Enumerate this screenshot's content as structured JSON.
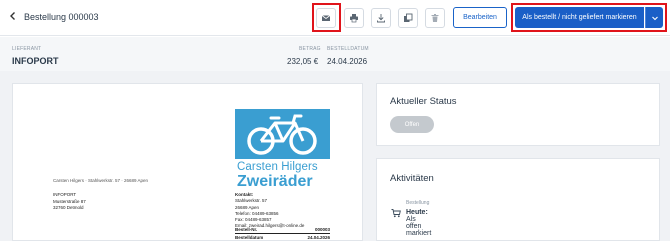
{
  "header": {
    "title": "Bestellung 000003",
    "edit_label": "Bearbeiten",
    "primary_label": "Als bestellt / nicht geliefert markieren",
    "toolbar_icons": [
      "mail-icon",
      "print-icon",
      "download-icon",
      "copy-icon",
      "trash-icon"
    ]
  },
  "info": {
    "supplier_label": "LIEFERANT",
    "supplier": "INFOPORT",
    "amount_label": "BETRAG",
    "amount": "232,05 €",
    "date_label": "BESTELLDATUM",
    "date": "24.04.2026"
  },
  "document": {
    "sender_line": "Carsten Hilgers · Stahlwerkstr. 57 · 26689 Apen",
    "recipient": [
      "INFOPORT",
      "Musterstraße 87",
      "32760 Detmold"
    ],
    "logo_line1": "Carsten Hilgers",
    "logo_line2": "Zweiräder",
    "contact_title": "Kontakt:",
    "contact_lines": [
      "Stahlwerkstr. 57",
      "26689 Apen",
      "Telefon: 04489-63856",
      "Fax: 04489-63857",
      "Email: zweirad.hilgers@t-online.de"
    ],
    "order_no_label": "Bestell-Nr.",
    "order_no": "000003",
    "order_date_label": "Bestelldatum",
    "order_date": "24.04.2026"
  },
  "status": {
    "title": "Aktueller Status",
    "badge": "Offen"
  },
  "activities": {
    "title": "Aktivitäten",
    "item_label": "Bestellung",
    "item_strong": "Heute:",
    "item_text": " Als offen markiert"
  },
  "colors": {
    "primary": "#1a5fc7",
    "highlight": "#e0141b",
    "logo_blue": "#3a9ed1",
    "status_badge": "#c4c9ce"
  }
}
